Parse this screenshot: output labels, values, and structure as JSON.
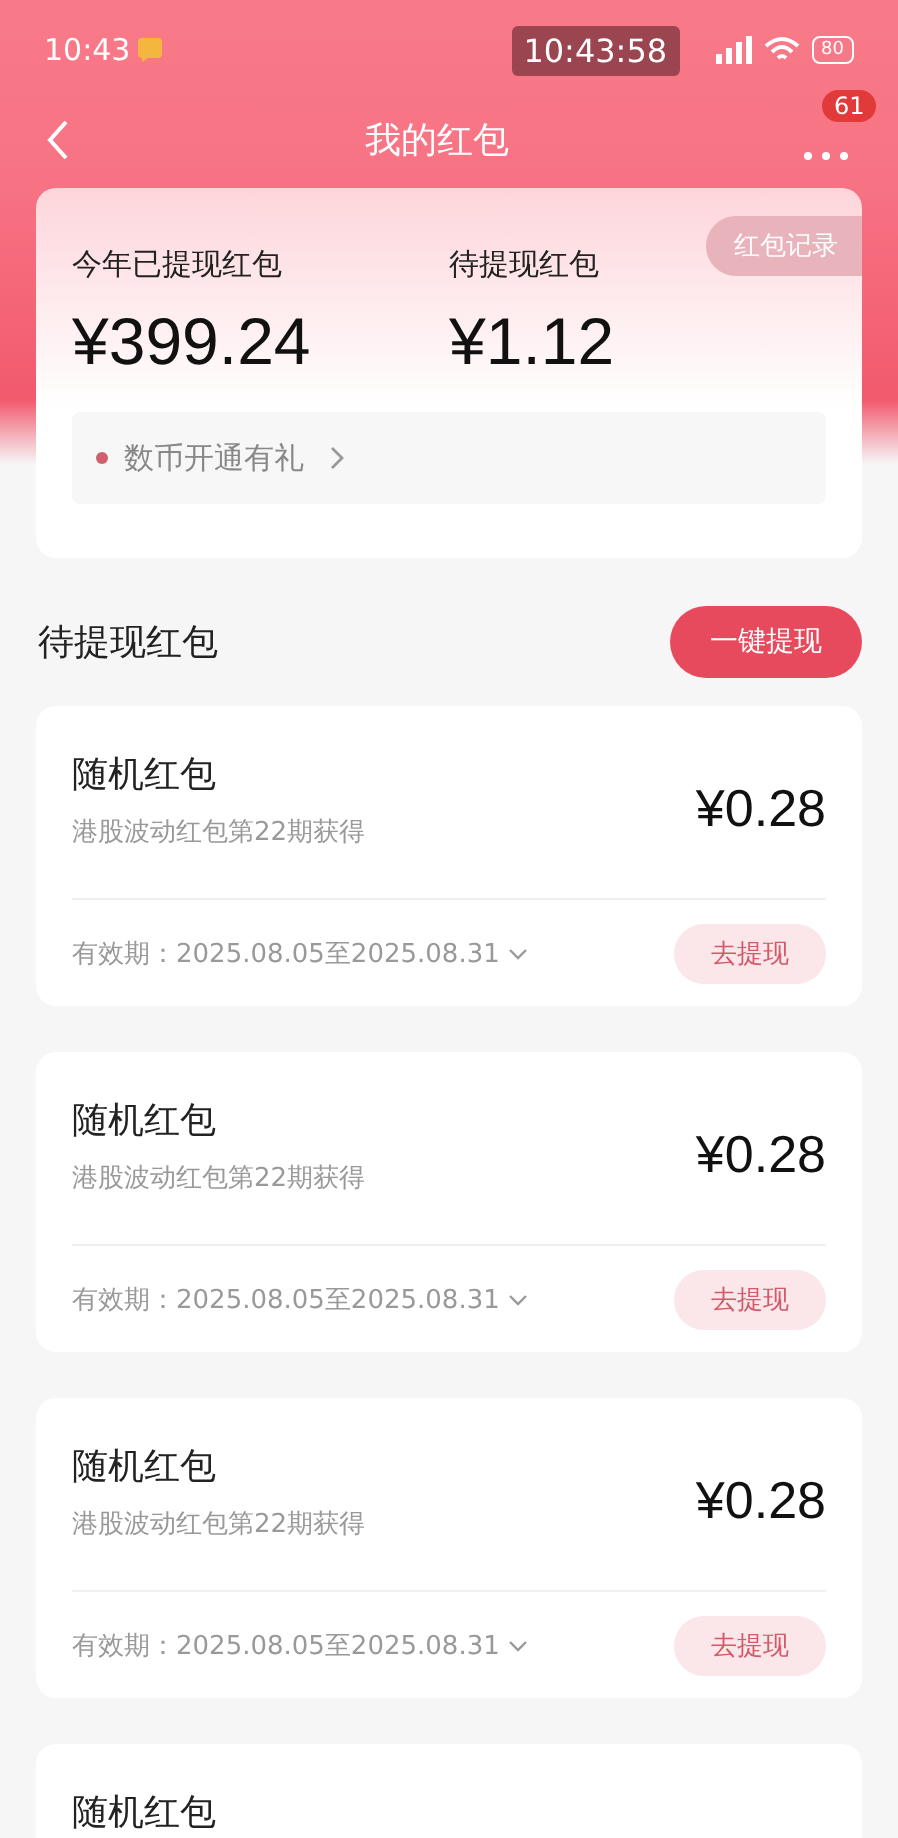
{
  "status_bar": {
    "time": "10:43",
    "clock": "10:43:58",
    "battery": "80"
  },
  "nav": {
    "title": "我的红包",
    "badge": "61"
  },
  "summary": {
    "record_button": "红包记录",
    "stats": [
      {
        "label": "今年已提现红包",
        "amount": "¥399.24"
      },
      {
        "label": "待提现红包",
        "amount": "¥1.12"
      }
    ],
    "promo": {
      "text": "数币开通有礼",
      "color": "#d0606e"
    }
  },
  "section": {
    "title": "待提现红包",
    "button": "一键提现"
  },
  "packets": [
    {
      "title": "随机红包",
      "source": "港股波动红包第22期获得",
      "amount": "¥0.28",
      "validity": "有效期：2025.08.05至2025.08.31",
      "button": "去提现"
    },
    {
      "title": "随机红包",
      "source": "港股波动红包第22期获得",
      "amount": "¥0.28",
      "validity": "有效期：2025.08.05至2025.08.31",
      "button": "去提现"
    },
    {
      "title": "随机红包",
      "source": "港股波动红包第22期获得",
      "amount": "¥0.28",
      "validity": "有效期：2025.08.05至2025.08.31",
      "button": "去提现"
    },
    {
      "title": "随机红包"
    }
  ]
}
